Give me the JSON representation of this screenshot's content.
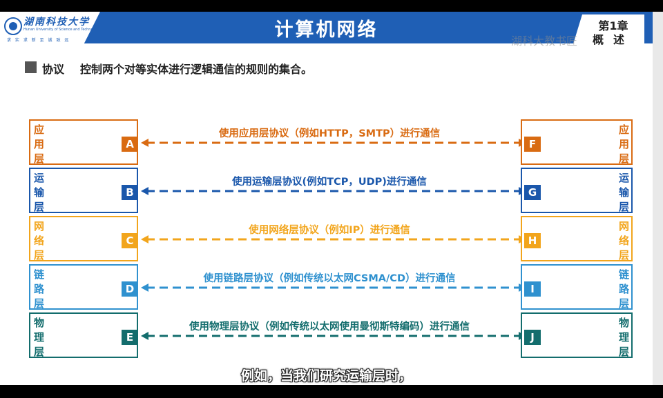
{
  "header": {
    "university_cn": "湖南科技大学",
    "university_en": "Hunan University of Science and Technology",
    "motto": "求 实 求 新     至 诚 致 远",
    "course_title": "计算机网络",
    "chapter_line1": "第1章",
    "chapter_line2": "概述",
    "watermark": "湖科大教书匠"
  },
  "section": {
    "term": "协议",
    "definition": "控制两个对等实体进行逻辑通信的规则的集合。"
  },
  "colors": {
    "header_blue": "#1f5fb5",
    "application": "#d96b12",
    "transport": "#1a57ab",
    "network": "#f2a51c",
    "link": "#2f91cf",
    "physical": "#136d6d"
  },
  "layers": [
    {
      "name": "应用层",
      "left_letter": "A",
      "right_letter": "F",
      "color": "#d96b12",
      "label": "使用应用层协议（例如HTTP，SMTP）进行通信"
    },
    {
      "name": "运输层",
      "left_letter": "B",
      "right_letter": "G",
      "color": "#1a57ab",
      "label": "使用运输层协议(例如TCP，UDP)进行通信"
    },
    {
      "name": "网络层",
      "left_letter": "C",
      "right_letter": "H",
      "color": "#f2a51c",
      "label": "使用网络层协议（例如IP）进行通信"
    },
    {
      "name": "链路层",
      "left_letter": "D",
      "right_letter": "I",
      "color": "#2f91cf",
      "label": "使用链路层协议（例如传统以太网CSMA/CD）进行通信"
    },
    {
      "name": "物理层",
      "left_letter": "E",
      "right_letter": "J",
      "color": "#136d6d",
      "label": "使用物理层协议（例如传统以太网使用曼彻斯特编码）进行通信"
    }
  ],
  "subtitle": "例如，当我们研究运输层时，"
}
